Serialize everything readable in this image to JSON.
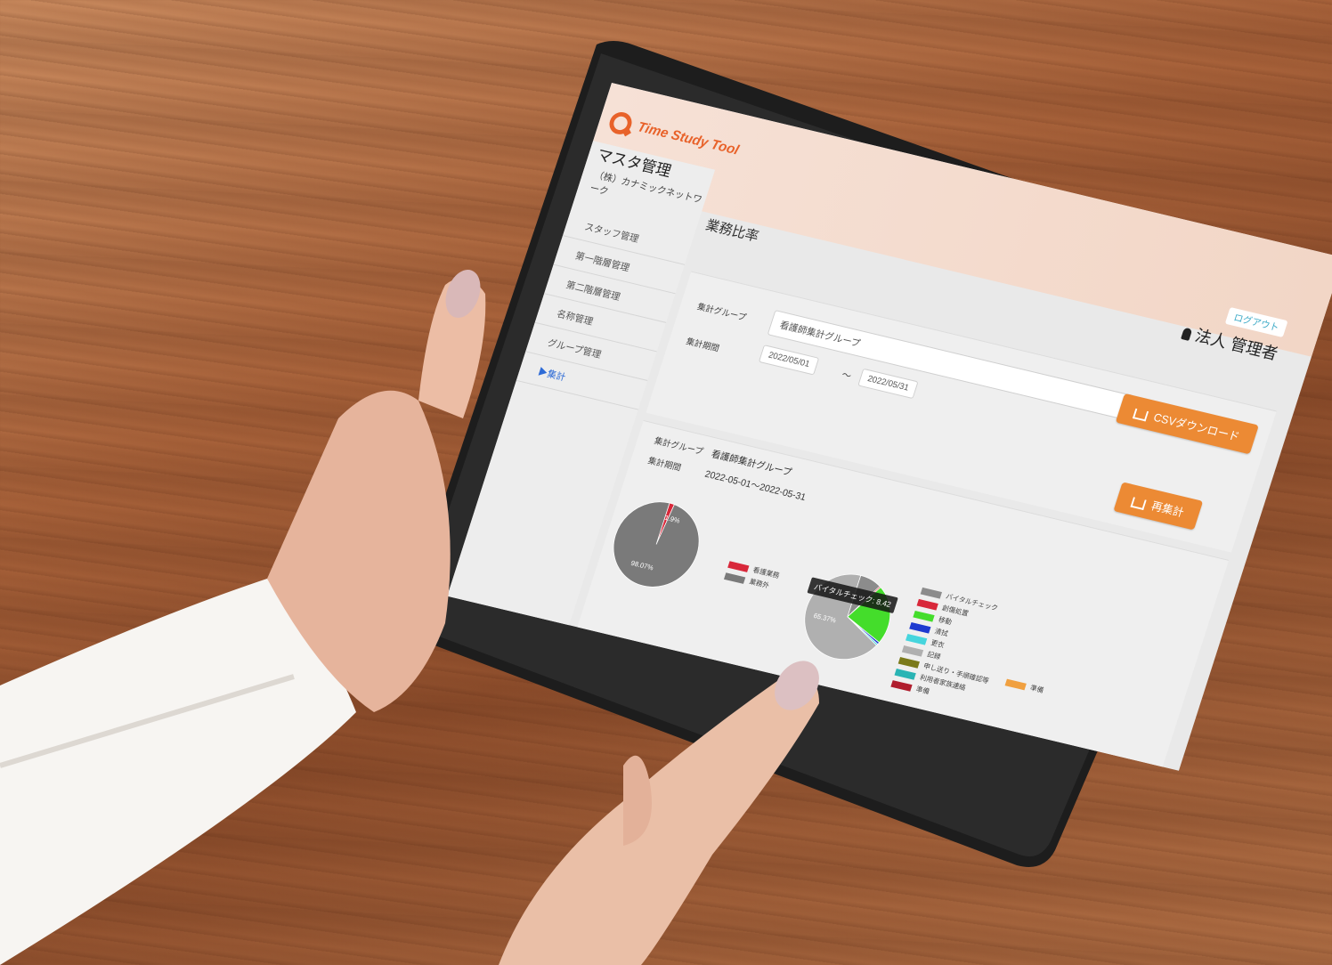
{
  "app": {
    "name": "Time Study Tool"
  },
  "header": {
    "logout_label": "ログアウト",
    "user_label": "法人 管理者"
  },
  "sidebar": {
    "title": "マスタ管理",
    "org": "（株）カナミックネットワーク",
    "items": [
      {
        "label": "スタッフ管理"
      },
      {
        "label": "第一階層管理"
      },
      {
        "label": "第二階層管理"
      },
      {
        "label": "名称管理"
      },
      {
        "label": "グループ管理"
      },
      {
        "label": "▶集計"
      }
    ]
  },
  "main": {
    "title": "業務比率",
    "filter": {
      "group_label": "集計グループ",
      "group_value": "看護師集計グループ",
      "period_label": "集計期間",
      "date_from": "2022/05/01",
      "date_sep": "～",
      "date_to": "2022/05/31"
    },
    "csv_button": "CSVダウンロード",
    "recalc_button": "再集計",
    "result": {
      "group_label": "集計グループ",
      "group_value": "看護師集計グループ",
      "period_label": "集計期間",
      "period_value": "2022-05-01～2022-05-31"
    }
  },
  "chart_data": [
    {
      "type": "pie",
      "slices": [
        {
          "label": "看護業務",
          "value": 1.93,
          "color": "#d8283a"
        },
        {
          "label": "業務外",
          "value": 98.07,
          "color": "#7a7a7a"
        }
      ],
      "visible_labels": [
        "1.9%",
        "98.07%"
      ]
    },
    {
      "type": "pie",
      "slices": [
        {
          "label": "バイタルチェック",
          "value": 8.42,
          "color": "#8c8c8c"
        },
        {
          "label": "創傷処置",
          "value": 0.5,
          "color": "#d8283a"
        },
        {
          "label": "移動",
          "value": 22.0,
          "color": "#44dd2b"
        },
        {
          "label": "清拭",
          "value": 0.8,
          "color": "#1e3ad0"
        },
        {
          "label": "更衣",
          "value": 0.6,
          "color": "#46d5dd"
        },
        {
          "label": "記録",
          "value": 65.37,
          "color": "#b0b0b0"
        }
      ],
      "visible_labels": [
        "65.37%"
      ],
      "tooltip": "バイタルチェック: 8.42"
    }
  ],
  "legend_b": [
    {
      "label": "バイタルチェック",
      "color": "#8c8c8c"
    },
    {
      "label": "創傷処置",
      "color": "#d8283a"
    },
    {
      "label": "移動",
      "color": "#44dd2b"
    },
    {
      "label": "清拭",
      "color": "#1e3ad0"
    },
    {
      "label": "更衣",
      "color": "#46d5dd"
    },
    {
      "label": "記録",
      "color": "#b0b0b0"
    },
    {
      "label": "申し送り・手順確認等",
      "color": "#7b7a1a"
    },
    {
      "label": "利用者家族連絡",
      "color": "#2ab4b4"
    },
    {
      "label": "準備",
      "color": "#b01e2e"
    }
  ],
  "legend_extra": {
    "label": "準備",
    "color": "#f0a040"
  }
}
